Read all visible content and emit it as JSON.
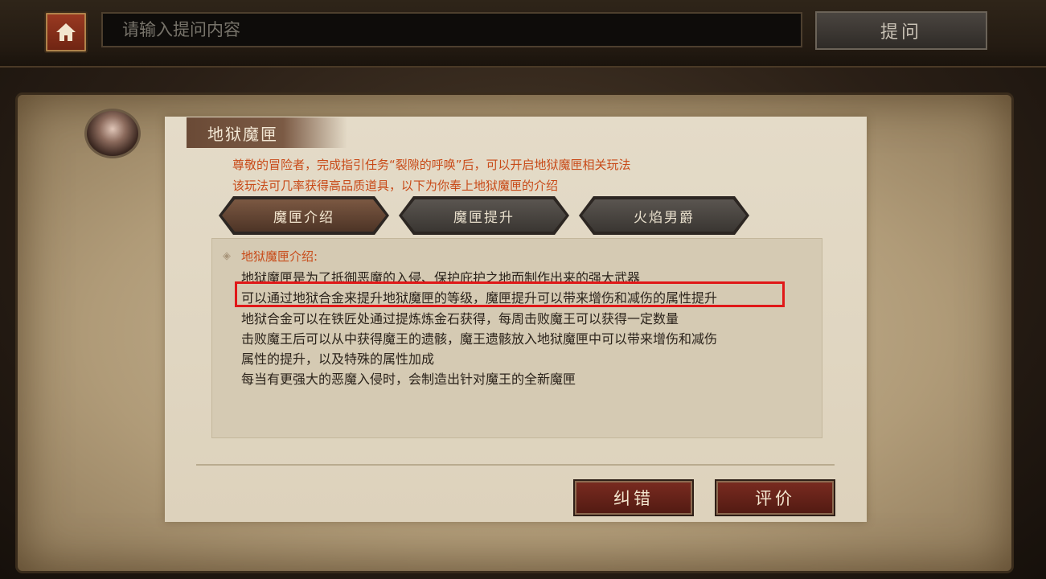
{
  "topbar": {
    "search_placeholder": "请输入提问内容",
    "ask_label": "提问"
  },
  "panel": {
    "title": "地狱魔匣",
    "intro_lines": [
      "尊敬的冒险者，完成指引任务“裂隙的呼唤”后，可以开启地狱魔匣相关玩法",
      "该玩法可几率获得高品质道具，以下为你奉上地狱魔匣的介绍"
    ],
    "tabs": [
      {
        "label": "魔匣介绍",
        "active": true
      },
      {
        "label": "魔匣提升",
        "active": false
      },
      {
        "label": "火焰男爵",
        "active": false
      }
    ],
    "section_title": "地狱魔匣介绍:",
    "body_lines": [
      "地狱魔匣是为了抵御恶魔的入侵、保护庇护之地而制作出来的强大武器",
      "可以通过地狱合金来提升地狱魔匣的等级，魔匣提升可以带来增伤和减伤的属性提升",
      "地狱合金可以在铁匠处通过提炼炼金石获得，每周击败魔王可以获得一定数量",
      "击败魔王后可以从中获得魔王的遗骸，魔王遗骸放入地狱魔匣中可以带来增伤和减伤",
      "属性的提升，以及特殊的属性加成",
      "每当有更强大的恶魔入侵时，会制造出针对魔王的全新魔匣"
    ],
    "buttons": {
      "report_label": "纠错",
      "rate_label": "评价"
    }
  },
  "colors": {
    "accent_text": "#c84a18",
    "highlight_border": "#e01818",
    "button_red": "#7a2b20"
  },
  "icons": {
    "home": "home-icon",
    "bullet": "diamond-bullet-icon"
  }
}
